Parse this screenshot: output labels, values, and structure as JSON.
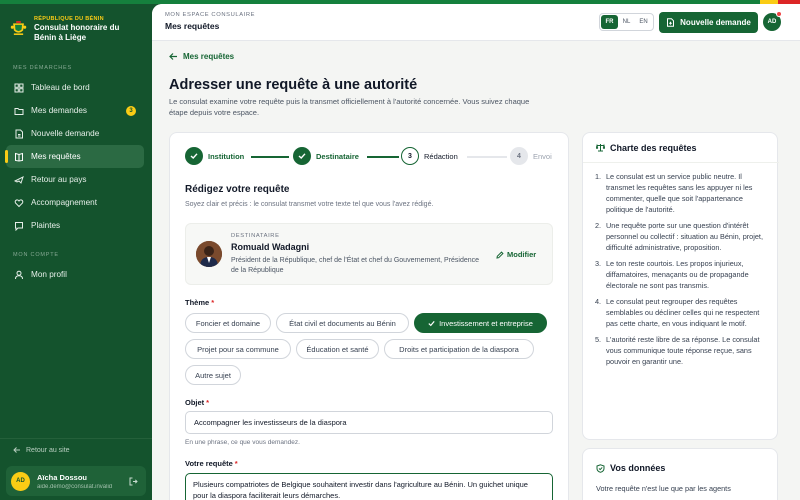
{
  "sidebar": {
    "brand_small": "RÉPUBLIQUE DU BÉNIN",
    "brand_title": "Consulat honoraire du Bénin à Liège",
    "section_demarches": "MES DÉMARCHES",
    "section_compte": "MON COMPTE",
    "items": [
      {
        "label": "Tableau de bord",
        "icon": "grid-icon"
      },
      {
        "label": "Mes demandes",
        "icon": "folder-icon",
        "badge": "3"
      },
      {
        "label": "Nouvelle demande",
        "icon": "file-icon"
      },
      {
        "label": "Mes requêtes",
        "icon": "book-icon",
        "active": true
      },
      {
        "label": "Retour au pays",
        "icon": "plane-icon"
      },
      {
        "label": "Accompagnement",
        "icon": "heart-icon"
      },
      {
        "label": "Plaintes",
        "icon": "alert-icon"
      }
    ],
    "account_items": [
      {
        "label": "Mon profil",
        "icon": "user-icon"
      }
    ],
    "back_to_site": "Retour au site",
    "user": {
      "initials": "AD",
      "name": "Aïcha Dossou",
      "email": "aide.demo@consulat.invalid"
    }
  },
  "header": {
    "small": "MON ESPACE CONSULAIRE",
    "title": "Mes requêtes",
    "languages": [
      "FR",
      "NL",
      "EN"
    ],
    "active_language": "FR",
    "new_request_label": "Nouvelle demande",
    "avatar_initials": "AD"
  },
  "page": {
    "back_label": "Mes requêtes",
    "title": "Adresser une requête à une autorité",
    "description": "Le consulat examine votre requête puis la transmet officiellement à l'autorité concernée. Vous suivez chaque étape depuis votre espace."
  },
  "steps": [
    {
      "label": "Institution",
      "state": "done",
      "number": "1"
    },
    {
      "label": "Destinataire",
      "state": "done",
      "number": "2"
    },
    {
      "label": "Rédaction",
      "state": "current",
      "number": "3"
    },
    {
      "label": "Envoi",
      "state": "todo",
      "number": "4"
    }
  ],
  "form": {
    "section_title": "Rédigez votre requête",
    "section_help": "Soyez clair et précis : le consulat transmet votre texte tel que vous l'avez rédigé.",
    "recipient": {
      "label": "DESTINATAIRE",
      "name": "Romuald Wadagni",
      "role": "Président de la République, chef de l'État et chef du Gouvernement, Présidence de la République",
      "edit_label": "Modifier"
    },
    "theme_label": "Thème",
    "required_mark": "*",
    "themes": [
      {
        "label": "Foncier et domaine",
        "selected": false
      },
      {
        "label": "État civil et documents au Bénin",
        "selected": false
      },
      {
        "label": "Investissement et entreprise",
        "selected": true
      },
      {
        "label": "Projet pour sa commune",
        "selected": false
      },
      {
        "label": "Éducation et santé",
        "selected": false
      },
      {
        "label": "Droits et participation de la diaspora",
        "selected": false
      },
      {
        "label": "Autre sujet",
        "selected": false
      }
    ],
    "object_label": "Objet",
    "object_value": "Accompagner les investisseurs de la diaspora",
    "object_hint": "En une phrase, ce que vous demandez.",
    "request_label": "Votre requête",
    "request_value": "Plusieurs compatriotes de Belgique souhaitent investir dans l'agriculture au Bénin. Un guichet unique pour la diaspora faciliterait leurs démarches."
  },
  "charte": {
    "title": "Charte des requêtes",
    "rules": [
      "Le consulat est un service public neutre. Il transmet les requêtes sans les appuyer ni les commenter, quelle que soit l'appartenance politique de l'autorité.",
      "Une requête porte sur une question d'intérêt personnel ou collectif : situation au Bénin, projet, difficulté administrative, proposition.",
      "Le ton reste courtois. Les propos injurieux, diffamatoires, menaçants ou de propagande électorale ne sont pas transmis.",
      "Le consulat peut regrouper des requêtes semblables ou décliner celles qui ne respectent pas cette charte, en vous indiquant le motif.",
      "L'autorité reste libre de sa réponse. Le consulat vous communique toute réponse reçue, sans pouvoir en garantir une."
    ]
  },
  "donnees": {
    "title": "Vos données",
    "text": "Votre requête n'est lue que par les agents"
  },
  "colors": {
    "primary": "#166534",
    "sidebar": "#14532d",
    "accent": "#facc15",
    "danger": "#dc2626"
  }
}
